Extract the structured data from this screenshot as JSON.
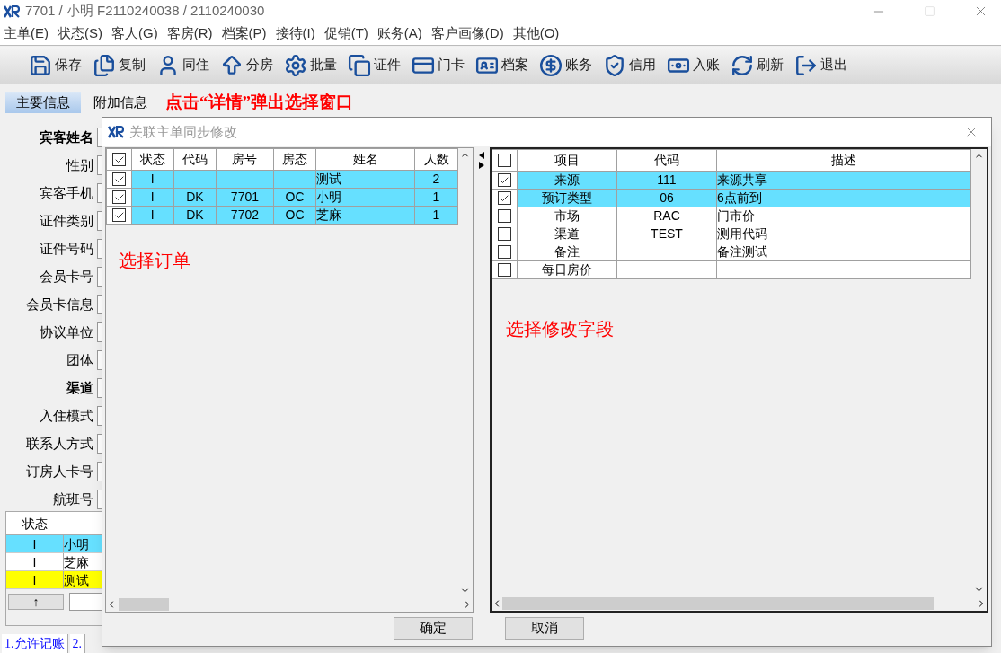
{
  "window": {
    "title": "7701 / 小明 F2110240038 / 2110240030"
  },
  "menu": [
    "主单(E)",
    "状态(S)",
    "客人(G)",
    "客房(R)",
    "档案(P)",
    "接待(I)",
    "促销(T)",
    "账务(A)",
    "客户画像(D)",
    "其他(O)"
  ],
  "toolbar": [
    "保存",
    "复制",
    "同住",
    "分房",
    "批量",
    "证件",
    "门卡",
    "档案",
    "账务",
    "信用",
    "入账",
    "刷新",
    "退出"
  ],
  "tabs": [
    {
      "label": "主要信息",
      "selected": true
    },
    {
      "label": "附加信息",
      "selected": false
    }
  ],
  "annotation_top": "点击“详情”弹出选择窗口",
  "form_labels": [
    {
      "label": "宾客姓名",
      "emphasized": true
    },
    {
      "label": "性别",
      "emphasized": false
    },
    {
      "label": "宾客手机",
      "emphasized": false
    },
    {
      "label": "证件类别",
      "emphasized": false
    },
    {
      "label": "证件号码",
      "emphasized": false
    },
    {
      "label": "会员卡号",
      "emphasized": false
    },
    {
      "label": "会员卡信息",
      "emphasized": false
    },
    {
      "label": "协议单位",
      "emphasized": false
    },
    {
      "label": "团体",
      "emphasized": false
    },
    {
      "label": "渠道",
      "emphasized": true
    },
    {
      "label": "入住模式",
      "emphasized": false
    },
    {
      "label": "联系人方式",
      "emphasized": false
    },
    {
      "label": "订房人卡号",
      "emphasized": false
    },
    {
      "label": "航班号",
      "emphasized": false
    }
  ],
  "guest_grid": {
    "columns": [
      "状态"
    ],
    "rows": [
      {
        "status": "I",
        "name": "小明",
        "color": "#66e0ff"
      },
      {
        "status": "I",
        "name": "芝麻",
        "color": "#ffffff"
      },
      {
        "status": "I",
        "name": "测试",
        "color": "#ffff00"
      }
    ],
    "up_button": "↑"
  },
  "status_tabs": [
    "1.允许记账",
    "2."
  ],
  "dialog": {
    "title": "关联主单同步修改",
    "orders": {
      "all_checked": true,
      "columns": [
        "状态",
        "代码",
        "房号",
        "房态",
        "姓名",
        "人数"
      ],
      "rows": [
        {
          "checked": true,
          "selected": true,
          "cells": [
            "I",
            "",
            "",
            "",
            "测试",
            "2"
          ]
        },
        {
          "checked": true,
          "selected": true,
          "cells": [
            "I",
            "DK",
            "7701",
            "OC",
            "小明",
            "1"
          ]
        },
        {
          "checked": true,
          "selected": true,
          "cells": [
            "I",
            "DK",
            "7702",
            "OC",
            "芝麻",
            "1"
          ]
        }
      ]
    },
    "annotation_orders": "选择订单",
    "fields": {
      "all_checked": false,
      "columns": [
        "项目",
        "代码",
        "描述"
      ],
      "rows": [
        {
          "checked": true,
          "selected": true,
          "cells": [
            "来源",
            "111",
            "来源共享"
          ]
        },
        {
          "checked": true,
          "selected": true,
          "cells": [
            "预订类型",
            "06",
            "6点前到"
          ]
        },
        {
          "checked": false,
          "selected": false,
          "cells": [
            "市场",
            "RAC",
            "门市价"
          ]
        },
        {
          "checked": false,
          "selected": false,
          "cells": [
            "渠道",
            "TEST",
            "测用代码"
          ]
        },
        {
          "checked": false,
          "selected": false,
          "cells": [
            "备注",
            "",
            "备注测试"
          ]
        },
        {
          "checked": false,
          "selected": false,
          "cells": [
            "每日房价",
            "",
            ""
          ]
        }
      ]
    },
    "annotation_fields": "选择修改字段",
    "buttons": [
      "确定",
      "取消"
    ]
  }
}
